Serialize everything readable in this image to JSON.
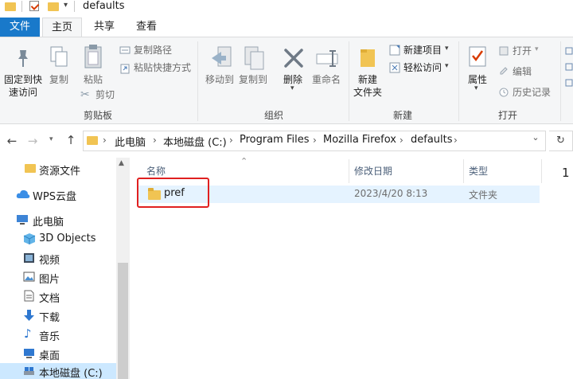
{
  "window": {
    "title": "defaults"
  },
  "tabs": [
    {
      "label": "文件"
    },
    {
      "label": "主页"
    },
    {
      "label": "共享"
    },
    {
      "label": "查看"
    }
  ],
  "ribbon": {
    "clipboard": {
      "pin_label_1": "固定到快",
      "pin_label_2": "速访问",
      "copy_label": "复制",
      "paste_label": "粘贴",
      "copy_path_label": "复制路径",
      "paste_shortcut_label": "粘贴快捷方式",
      "cut_label": "剪切",
      "group_label": "剪贴板"
    },
    "organize": {
      "move_to_label": "移动到",
      "copy_to_label": "复制到",
      "delete_label": "删除",
      "rename_label": "重命名",
      "group_label": "组织"
    },
    "new": {
      "new_folder_label_1": "新建",
      "new_folder_label_2": "文件夹",
      "new_item_label": "新建项目",
      "easy_access_label": "轻松访问",
      "group_label": "新建"
    },
    "open": {
      "properties_label": "属性",
      "open_label": "打开",
      "edit_label": "编辑",
      "history_label": "历史记录",
      "group_label": "打开"
    }
  },
  "address": {
    "breadcrumbs": [
      "此电脑",
      "本地磁盘 (C:)",
      "Program Files",
      "Mozilla Firefox",
      "defaults"
    ]
  },
  "nav_pane": {
    "items": [
      {
        "label": "资源文件",
        "icon": "folder-icon"
      },
      {
        "label": "WPS云盘",
        "icon": "cloud-icon"
      },
      {
        "label": "此电脑",
        "icon": "computer-icon"
      },
      {
        "label": "3D Objects",
        "icon": "cube-icon"
      },
      {
        "label": "视频",
        "icon": "video-icon"
      },
      {
        "label": "图片",
        "icon": "picture-icon"
      },
      {
        "label": "文档",
        "icon": "document-icon"
      },
      {
        "label": "下载",
        "icon": "download-icon"
      },
      {
        "label": "音乐",
        "icon": "music-icon"
      },
      {
        "label": "桌面",
        "icon": "desktop-icon"
      },
      {
        "label": "本地磁盘 (C:)",
        "icon": "drive-icon"
      }
    ]
  },
  "file_list": {
    "columns": {
      "name": "名称",
      "date": "修改日期",
      "type": "类型"
    },
    "rows": [
      {
        "name": "pref",
        "date": "2023/4/20 8:13",
        "type": "文件夹"
      }
    ],
    "side_count": "1"
  },
  "colors": {
    "accent": "#1979ca",
    "folder": "#f1c453",
    "selection": "#cce8ff",
    "hover": "#e5f3ff",
    "highlight": "#e02020"
  }
}
